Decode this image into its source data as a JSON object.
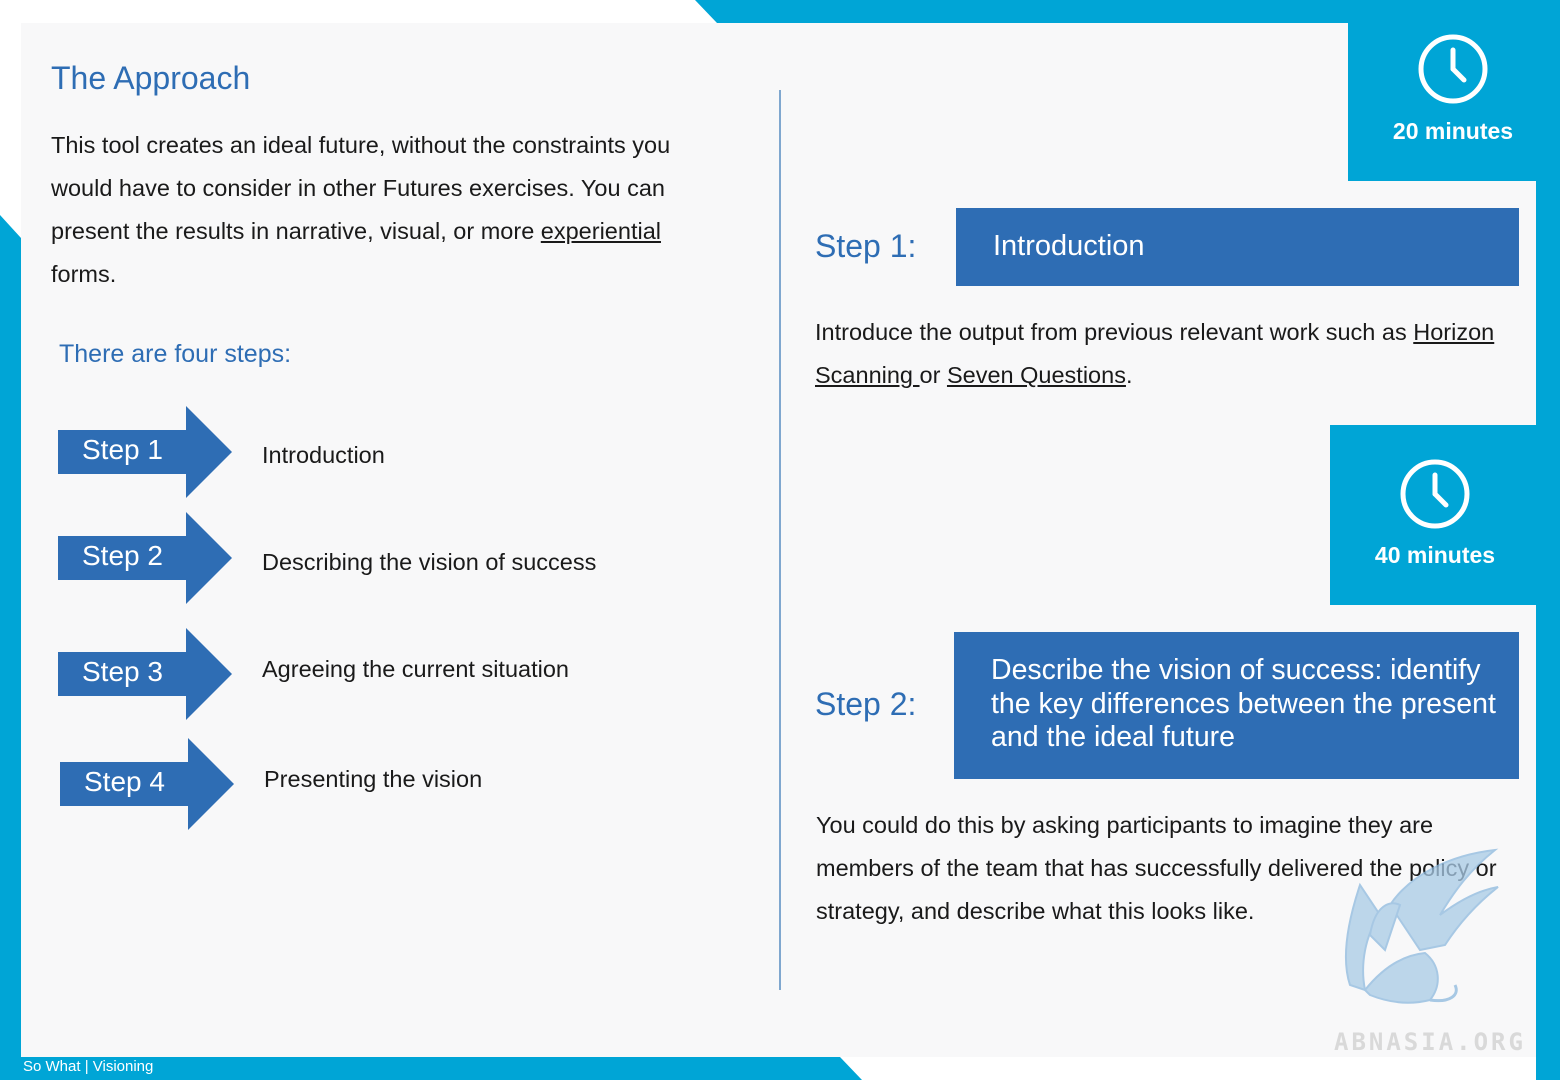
{
  "page": {
    "title": "The Approach",
    "intro": {
      "part1": "This tool creates an ideal future, without the constraints you would have to consider in other Futures exercises. You can present the results in narrative, visual, or more ",
      "link": "experiential",
      "part2": " forms."
    },
    "steps_heading": "There are four steps:",
    "steps": [
      {
        "label": "Step 1",
        "text": "Introduction"
      },
      {
        "label": "Step 2",
        "text": "Describing the vision of success"
      },
      {
        "label": "Step 3",
        "text": "Agreeing the current situation"
      },
      {
        "label": "Step 4",
        "text": "Presenting the vision"
      }
    ]
  },
  "right": {
    "timer1": "20 minutes",
    "step1_heading": "Step 1:",
    "step1_box": "Introduction",
    "step1_body": {
      "part1": "Introduce the output from previous relevant work such as ",
      "link1": "Horizon Scanning ",
      "part2": "or ",
      "link2": "Seven Questions",
      "part3": "."
    },
    "timer2": "40 minutes",
    "step2_heading": "Step 2:",
    "step2_box": "Describe the vision of success: identify the key differences between the present and the ideal future",
    "step2_body": "You could do this by asking participants to imagine they are members of the team that has successfully delivered the policy or strategy, and describe what this looks like."
  },
  "footer": {
    "text": "So What | Visioning"
  },
  "watermark": {
    "text": "ABNASIA.ORG"
  },
  "colors": {
    "accent": "#00a5d6",
    "heading_blue": "#2e6db4",
    "box_blue": "#2e6db4"
  },
  "icons": [
    "clock-icon",
    "griffin-logo"
  ]
}
